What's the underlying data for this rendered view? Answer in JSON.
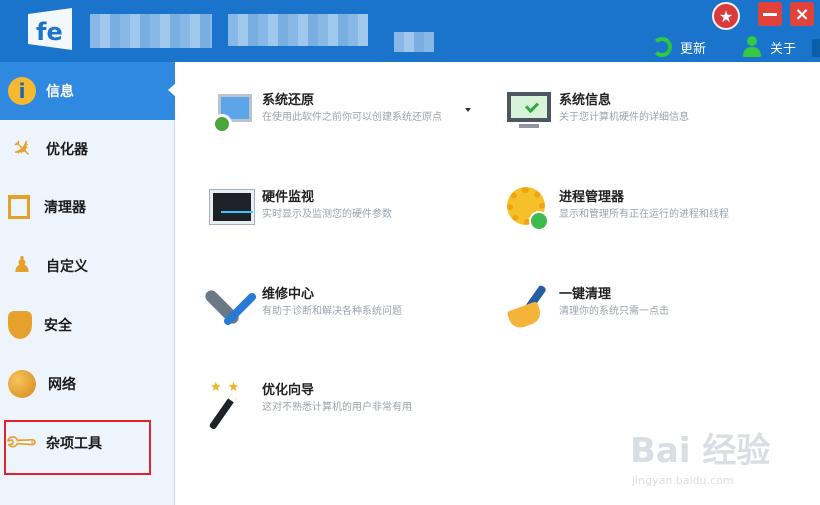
{
  "title_bar": {
    "refresh_label": "更新",
    "about_label": "关于",
    "background_color": "#1a74cc"
  },
  "sidebar": {
    "items": [
      {
        "label": "信息",
        "icon": "info-icon",
        "active": true
      },
      {
        "label": "优化器",
        "icon": "airplane-icon",
        "active": false
      },
      {
        "label": "清理器",
        "icon": "trash-icon",
        "active": false
      },
      {
        "label": "自定义",
        "icon": "person-icon",
        "active": false
      },
      {
        "label": "安全",
        "icon": "shield-icon",
        "active": false
      },
      {
        "label": "网络",
        "icon": "globe-icon",
        "active": false
      },
      {
        "label": "杂项工具",
        "icon": "wrench-icon",
        "active": false
      }
    ],
    "active_color": "#2f89e1",
    "highlight_color": "#e2222c"
  },
  "tools": [
    {
      "title": "系统还原",
      "description": "在使用此软件之前你可以创建系统还原点",
      "icon": "system-restore-icon"
    },
    {
      "title": "系统信息",
      "description": "关于您计算机硬件的详细信息",
      "icon": "monitor-check-icon"
    },
    {
      "title": "硬件监视",
      "description": "实时显示及监测您的硬件参数",
      "icon": "hardware-monitor-icon"
    },
    {
      "title": "进程管理器",
      "description": "显示和管理所有正在运行的进程和线程",
      "icon": "gear-check-icon"
    },
    {
      "title": "维修中心",
      "description": "有助于诊断和解决各种系统问题",
      "icon": "wrench-screwdriver-icon"
    },
    {
      "title": "一键清理",
      "description": "清理你的系统只需一点击",
      "icon": "broom-icon"
    },
    {
      "title": "优化向导",
      "description": "这对不熟悉计算机的用户非常有用",
      "icon": "magic-wand-icon"
    }
  ],
  "watermark": {
    "brand": "Bai 经验",
    "url": "jingyan.baidu.com"
  }
}
